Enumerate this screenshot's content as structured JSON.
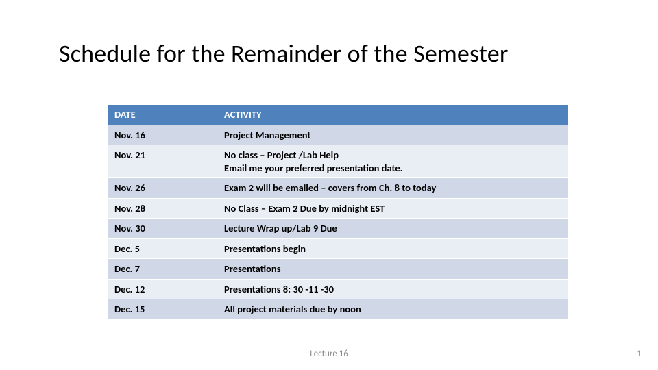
{
  "title": "Schedule for the Remainder of the Semester",
  "headers": {
    "date": "DATE",
    "activity": "ACTIVITY"
  },
  "rows": [
    {
      "date": "Nov. 16",
      "activity": "Project Management"
    },
    {
      "date": "Nov. 21",
      "activity": "No class – Project /Lab Help\nEmail me your preferred presentation date."
    },
    {
      "date": "Nov. 26",
      "activity": "Exam 2 will be emailed – covers from Ch. 8 to today"
    },
    {
      "date": "Nov. 28",
      "activity": "No Class – Exam 2 Due by midnight EST"
    },
    {
      "date": "Nov. 30",
      "activity": "Lecture Wrap up/Lab 9 Due"
    },
    {
      "date": "Dec. 5",
      "activity": "Presentations begin"
    },
    {
      "date": "Dec. 7",
      "activity": "Presentations"
    },
    {
      "date": "Dec. 12",
      "activity": "Presentations  8: 30 -11 -30"
    },
    {
      "date": "Dec. 15",
      "activity": "All project materials due by noon"
    }
  ],
  "footer": {
    "center": "Lecture 16",
    "pagenum": "1"
  },
  "colors": {
    "header_bg": "#4f81bd",
    "band_a": "#d0d8e8",
    "band_b": "#e9edf4"
  },
  "chart_data": {
    "type": "table",
    "title": "Schedule for the Remainder of the Semester",
    "columns": [
      "DATE",
      "ACTIVITY"
    ],
    "rows": [
      [
        "Nov. 16",
        "Project Management"
      ],
      [
        "Nov. 21",
        "No class – Project /Lab Help; Email me your preferred presentation date."
      ],
      [
        "Nov. 26",
        "Exam 2 will be emailed – covers from Ch. 8 to today"
      ],
      [
        "Nov. 28",
        "No Class – Exam 2 Due by midnight EST"
      ],
      [
        "Nov. 30",
        "Lecture Wrap up/Lab 9 Due"
      ],
      [
        "Dec. 5",
        "Presentations begin"
      ],
      [
        "Dec. 7",
        "Presentations"
      ],
      [
        "Dec. 12",
        "Presentations 8:30-11-30"
      ],
      [
        "Dec. 15",
        "All project materials due by noon"
      ]
    ]
  }
}
